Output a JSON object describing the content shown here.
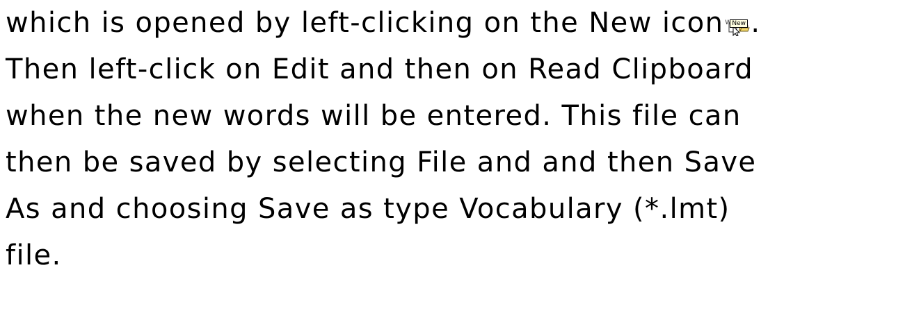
{
  "paragraph": {
    "line1_before_icon": "which is opened by left-clicking on the New icon",
    "line1_after_icon": ".",
    "line2": "Then left-click on Edit and then on Read Clipboard",
    "line3": "when the new words will be entered. This file can",
    "line4": "then be saved by selecting File and and then Save",
    "line5": "As and choosing Save as type Vocabulary (*.lmt)",
    "line6": "file."
  },
  "new_icon": {
    "tooltip": "New",
    "toolbar_letter": "W"
  }
}
